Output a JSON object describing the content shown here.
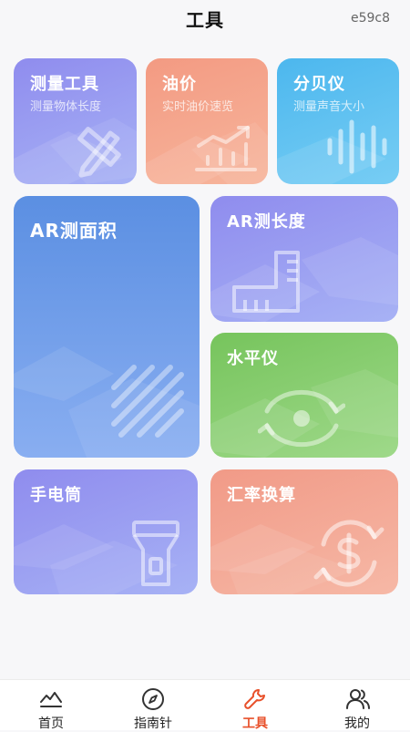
{
  "header": {
    "title": "工具",
    "code": "e59c8"
  },
  "cards": {
    "measure": {
      "label": "测量工具",
      "sub": "测量物体长度"
    },
    "oil": {
      "label": "油价",
      "sub": "实时油价速览"
    },
    "decibel": {
      "label": "分贝仪",
      "sub": "测量声音大小"
    },
    "ar_area": {
      "label": "AR测面积"
    },
    "ar_length": {
      "label": "AR测长度"
    },
    "level": {
      "label": "水平仪"
    },
    "flashlight": {
      "label": "手电筒"
    },
    "exchange": {
      "label": "汇率换算"
    }
  },
  "tabbar": {
    "home": "首页",
    "compass": "指南针",
    "tools": "工具",
    "mine": "我的",
    "active_color": "#e8512b"
  }
}
